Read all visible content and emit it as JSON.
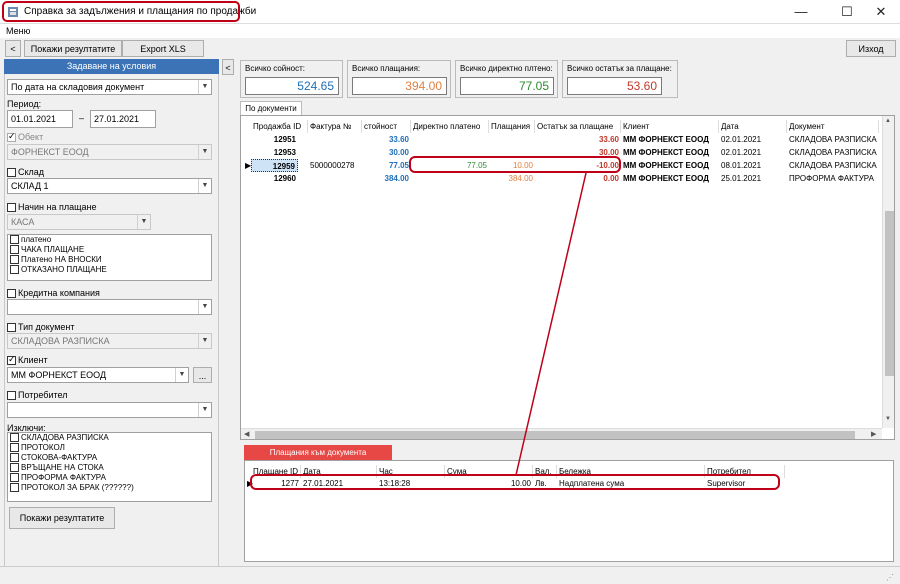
{
  "window": {
    "title": "Справка за задължения и плащания по продажби",
    "minimize": "—",
    "maximize": "☐",
    "close": "✕"
  },
  "menu": {
    "label": "Меню"
  },
  "toolbar": {
    "back": "<",
    "show_results": "Покажи резултатите",
    "export": "Export XLS",
    "exit": "Изход"
  },
  "filters": {
    "header": "Задаване на условия",
    "date_mode": "По дата на складовия документ",
    "period_label": "Период:",
    "date_from": "01.01.2021",
    "date_sep": "–",
    "date_to": "27.01.2021",
    "object_label": "Обект",
    "object_value": "ФОРНЕКСТ ЕООД",
    "warehouse_label": "Склад",
    "warehouse_value": "СКЛАД 1",
    "payment_method_label": "Начин на плащане",
    "payment_method_value": "КАСА",
    "payment_statuses": [
      "платено",
      "ЧАКА ПЛАЩАНЕ",
      "Платено НА ВНОСКИ",
      "ОТКАЗАНО ПЛАЩАНЕ"
    ],
    "credit_label": "Кредитна компания",
    "doctype_label": "Тип документ",
    "doctype_value": "СКЛАДОВА РАЗПИСКА",
    "client_label": "Клиент",
    "client_value": "ММ ФОРНЕКСТ ЕООД",
    "client_more": "...",
    "consumer_label": "Потребител",
    "exclude_label": "Изключи:",
    "excludes": [
      "СКЛАДОВА РАЗПИСКА",
      "ПРОТОКОЛ",
      "СТОКОВА-ФАКТУРА",
      "ВРЪЩАНЕ НА СТОКА",
      "ПРОФОРМА ФАКТУРА",
      "ПРОТОКОЛ ЗА БРАК (??????)"
    ],
    "show_button": "Покажи резултатите",
    "collapse": "<"
  },
  "summary": [
    {
      "label": "Всичко сойност:",
      "value": "524.65",
      "color": "#1e6fb8"
    },
    {
      "label": "Всичко плащания:",
      "value": "394.00",
      "color": "#e08040"
    },
    {
      "label": "Всичко директно плтено:",
      "value": "77.05",
      "color": "#2e8b2e"
    },
    {
      "label": "Всичко остатък за плащане:",
      "value": "53.60",
      "color": "#c0392b"
    }
  ],
  "docs_tab": "По документи",
  "docs_grid": {
    "columns": [
      "Продажба ID",
      "Фактура №",
      "стойност",
      "Директно платено",
      "Плащания",
      "Остатък за плащане",
      "Клиент",
      "Дата",
      "Документ"
    ],
    "rows": [
      {
        "id": "12951",
        "invoice": "",
        "value": "33.60",
        "direct": "",
        "payments": "",
        "rest": "33.60",
        "client": "ММ ФОРНЕКСТ ЕООД",
        "date": "02.01.2021",
        "doc": "СКЛАДОВА РАЗПИСКА"
      },
      {
        "id": "12953",
        "invoice": "",
        "value": "30.00",
        "direct": "",
        "payments": "",
        "rest": "30.00",
        "client": "ММ ФОРНЕКСТ ЕООД",
        "date": "02.01.2021",
        "doc": "СКЛАДОВА РАЗПИСКА"
      },
      {
        "id": "12959",
        "invoice": "5000000278",
        "value": "77.05",
        "direct": "77.05",
        "payments": "10.00",
        "rest": "-10.00",
        "client": "ММ ФОРНЕКСТ ЕООД",
        "date": "08.01.2021",
        "doc": "СКЛАДОВА РАЗПИСКА"
      },
      {
        "id": "12960",
        "invoice": "",
        "value": "384.00",
        "direct": "",
        "payments": "384.00",
        "rest": "0.00",
        "client": "ММ ФОРНЕКСТ ЕООД",
        "date": "25.01.2021",
        "doc": "ПРОФОРМА ФАКТУРА"
      }
    ]
  },
  "payments_tab": "Плащания към документа",
  "payments_grid": {
    "columns": [
      "Плащане ID",
      "Дата",
      "Час",
      "Сума",
      "Вал.",
      "Бележка",
      "Потребител"
    ],
    "rows": [
      {
        "id": "1277",
        "date": "27.01.2021",
        "time": "13:18:28",
        "amount": "10.00",
        "currency": "Лв.",
        "note": "Надплатена сума",
        "user": "Supervisor"
      }
    ]
  },
  "colors": {
    "accent": "#3c73b6",
    "highlight": "#c00018",
    "tab_red": "#e74845",
    "value_blue": "#1e6fb8",
    "payment_orange": "#e08040",
    "direct_green": "#2e8b2e",
    "rest_red": "#c0392b"
  }
}
